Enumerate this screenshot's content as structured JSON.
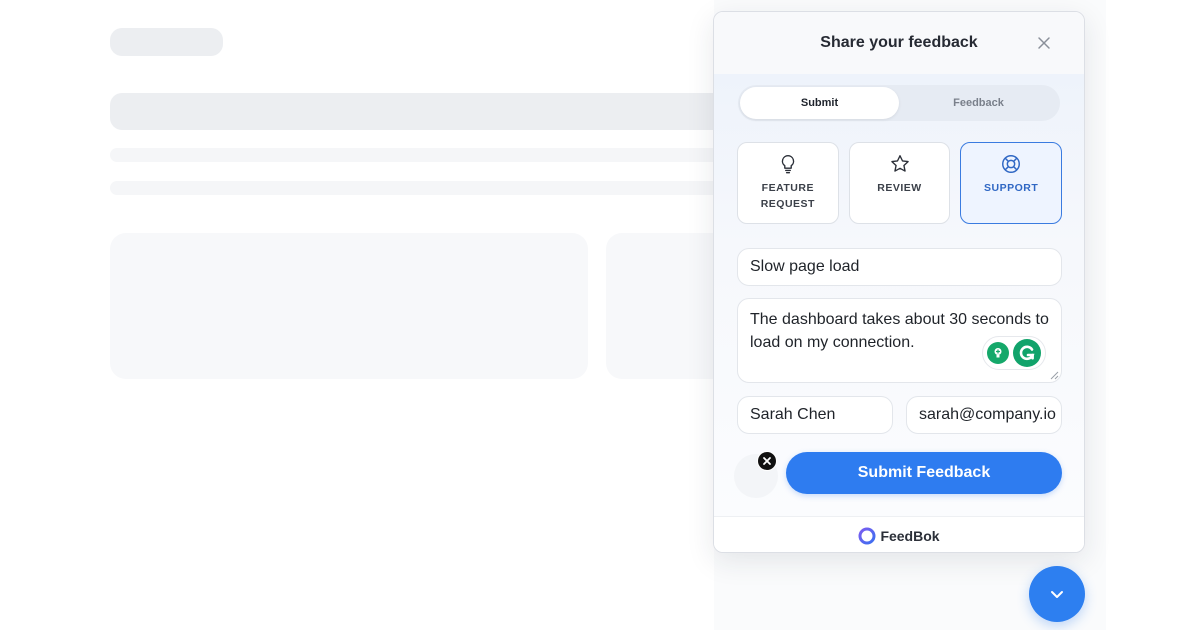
{
  "widget": {
    "title": "Share your feedback",
    "close_icon": "close-icon",
    "tabs": [
      {
        "label": "Submit",
        "active": true
      },
      {
        "label": "Feedback",
        "active": false
      }
    ],
    "types": [
      {
        "label": "FEATURE REQUEST",
        "icon": "lightbulb-icon",
        "selected": false
      },
      {
        "label": "REVIEW",
        "icon": "star-icon",
        "selected": false
      },
      {
        "label": "SUPPORT",
        "icon": "lifebuoy-icon",
        "selected": true
      }
    ],
    "subject_value": "Slow page load",
    "message_value": "The dashboard takes about 30 seconds to load on my connection.",
    "name_value": "Sarah Chen",
    "email_value": "sarah@company.io",
    "submit_label": "Submit Feedback",
    "footer_brand": "FeedBok"
  },
  "colors": {
    "accent": "#2e7cf0",
    "selected_type_border": "#3a7be0",
    "grammarly_green": "#15a86a"
  },
  "fab_icon": "chevron-down-icon"
}
